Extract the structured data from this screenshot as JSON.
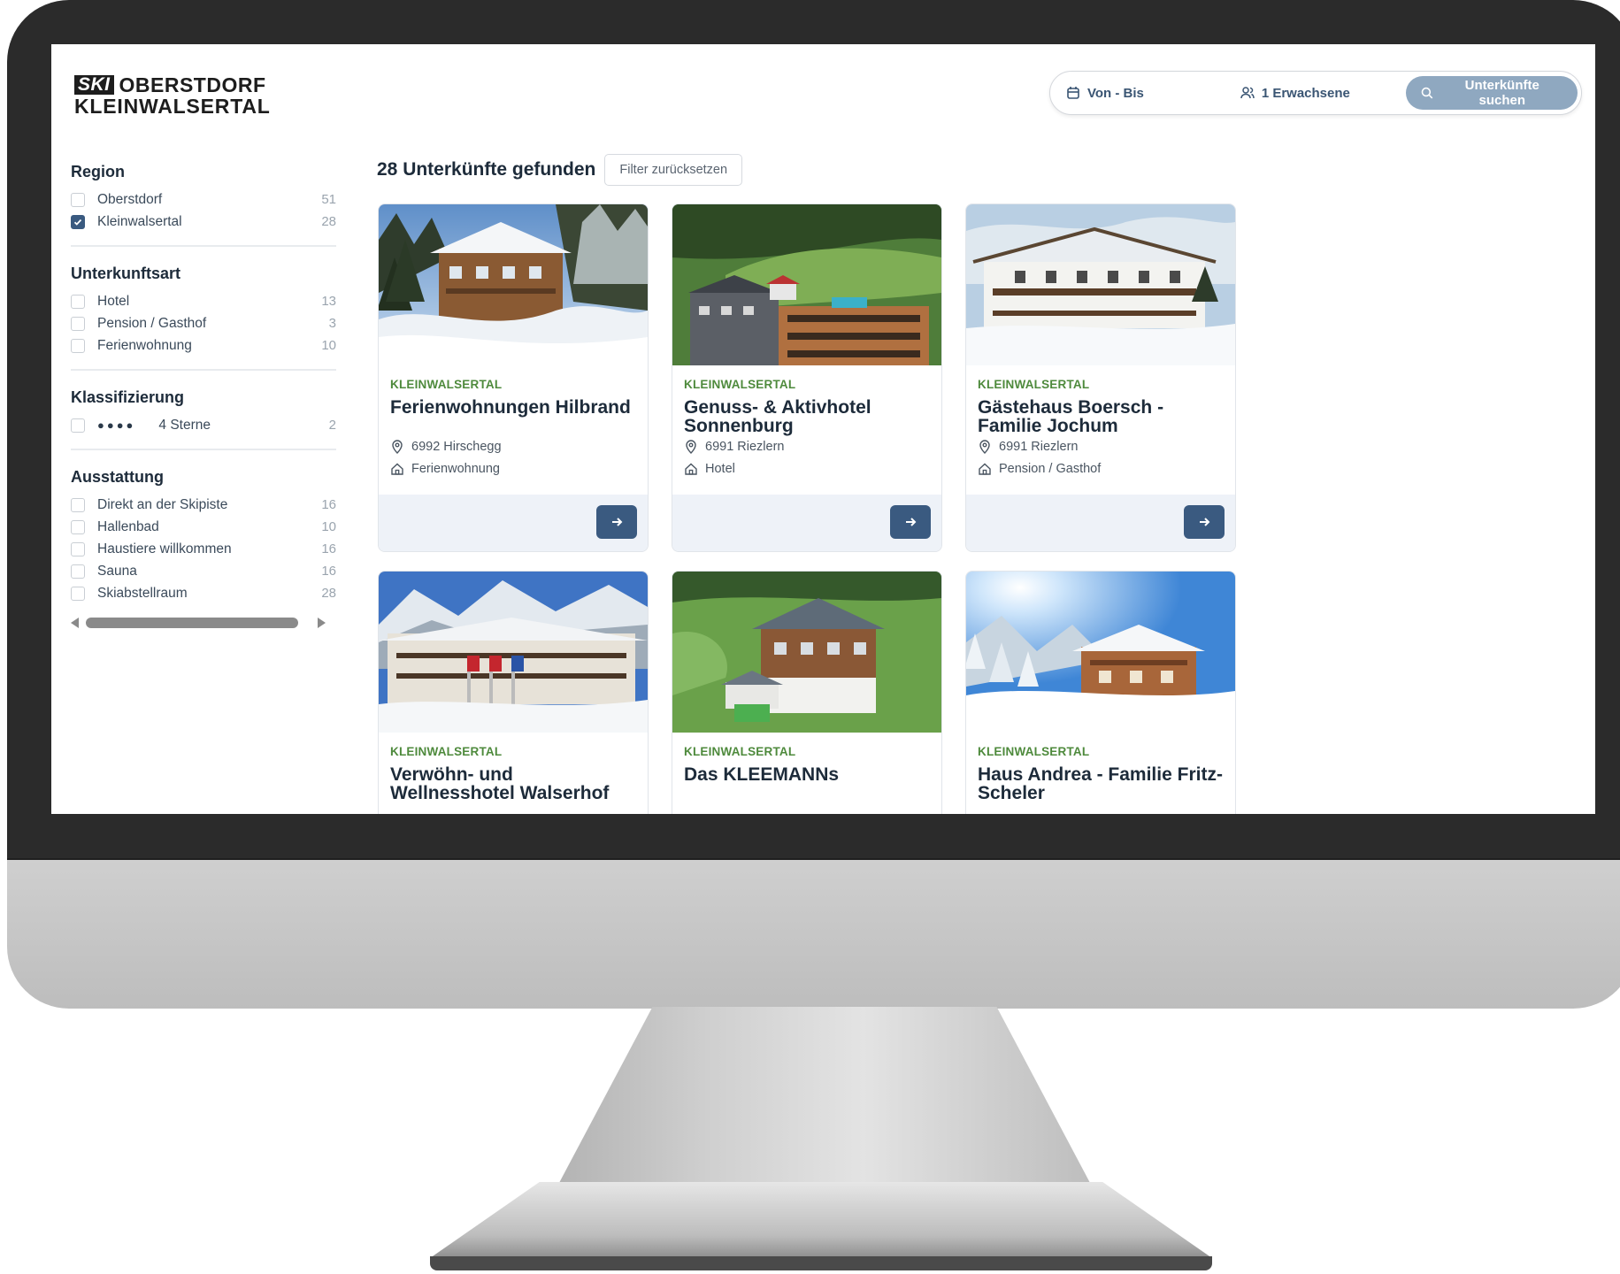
{
  "header": {
    "logo_badge": "SKI",
    "logo_line1": "OBERSTDORF",
    "logo_line2": "KLEINWALSERTAL",
    "dates_label": "Von - Bis",
    "guests_label": "1 Erwachsene",
    "search_button": "Unterkünfte suchen"
  },
  "sidebar": {
    "groups": [
      {
        "title": "Region",
        "items": [
          {
            "label": "Oberstdorf",
            "count": "51",
            "checked": false
          },
          {
            "label": "Kleinwalsertal",
            "count": "28",
            "checked": true
          }
        ]
      },
      {
        "title": "Unterkunftsart",
        "items": [
          {
            "label": "Hotel",
            "count": "13",
            "checked": false
          },
          {
            "label": "Pension / Gasthof",
            "count": "3",
            "checked": false
          },
          {
            "label": "Ferienwohnung",
            "count": "10",
            "checked": false
          }
        ]
      },
      {
        "title": "Klassifizierung",
        "items": [
          {
            "stars": "●●●●",
            "label": "4 Sterne",
            "count": "2",
            "checked": false
          }
        ]
      },
      {
        "title": "Ausstattung",
        "items": [
          {
            "label": "Direkt an der Skipiste",
            "count": "16",
            "checked": false
          },
          {
            "label": "Hallenbad",
            "count": "10",
            "checked": false
          },
          {
            "label": "Haustiere willkommen",
            "count": "16",
            "checked": false
          },
          {
            "label": "Sauna",
            "count": "16",
            "checked": false
          },
          {
            "label": "Skiabstellraum",
            "count": "28",
            "checked": false
          }
        ]
      }
    ]
  },
  "results": {
    "title": "28 Unterkünfte gefunden",
    "reset_label": "Filter zurücksetzen",
    "cards": [
      {
        "region": "KLEINWALSERTAL",
        "name": "Ferienwohnungen Hilbrand",
        "location": "6992 Hirschegg",
        "type": "Ferienwohnung"
      },
      {
        "region": "KLEINWALSERTAL",
        "name": "Genuss- & Aktivhotel Sonnenburg",
        "location": "6991 Riezlern",
        "type": "Hotel"
      },
      {
        "region": "KLEINWALSERTAL",
        "name": "Gästehaus Boersch - Familie Jochum",
        "location": "6991 Riezlern",
        "type": "Pension / Gasthof"
      },
      {
        "region": "KLEINWALSERTAL",
        "name": "Verwöhn- und Wellnesshotel Walserhof"
      },
      {
        "region": "KLEINWALSERTAL",
        "name": "Das KLEEMANNs"
      },
      {
        "region": "KLEINWALSERTAL",
        "name": "Haus Andrea - Familie Fritz-Scheler"
      }
    ]
  },
  "colors": {
    "accent": "#3a5a80",
    "region_green": "#4e8a3c",
    "search_button": "#8fa8c0",
    "card_footer": "#eef2f8"
  }
}
